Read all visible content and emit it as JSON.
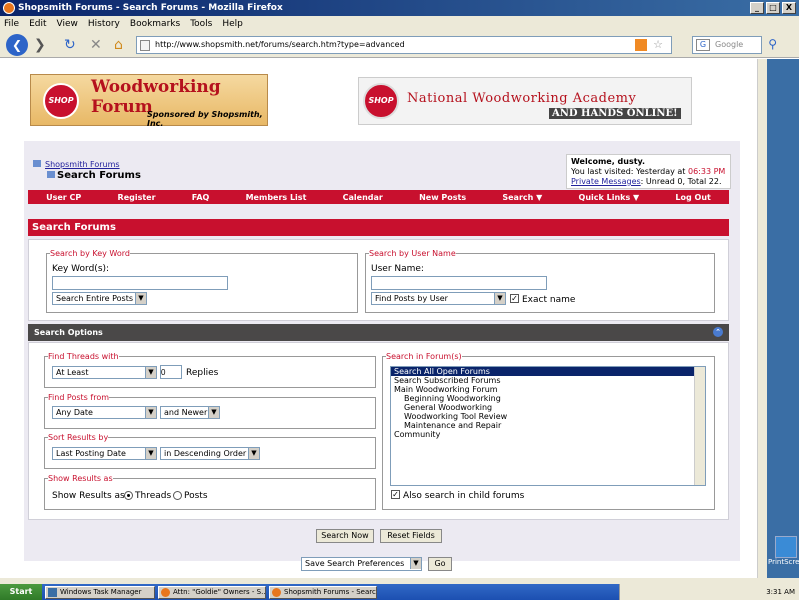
{
  "window": {
    "title": "Shopsmith Forums - Search Forums - Mozilla Firefox",
    "min": "_",
    "max": "□",
    "close": "X"
  },
  "menu": [
    "File",
    "Edit",
    "View",
    "History",
    "Bookmarks",
    "Tools",
    "Help"
  ],
  "browser": {
    "url": "http://www.shopsmith.net/forums/search.htm?type=advanced",
    "search_placeholder": "Google"
  },
  "logo1": {
    "brand": "SHOP SMITH",
    "line1": "Woodworking",
    "line2": "Forum",
    "sponsor": "Sponsored by Shopsmith, Inc."
  },
  "logo2": {
    "brand": "SHOP SMITH",
    "line1": "National Woodworking Academy",
    "line2": "AND HANDS ONLINE!"
  },
  "breadcrumb": {
    "parent": "Shopsmith Forums",
    "current": "Search Forums"
  },
  "welcome": {
    "greeting": "Welcome, dusty.",
    "visited_prefix": "You last visited: Yesterday at",
    "visited_time": "06:33 PM",
    "pm_link": "Private Messages",
    "pm_stats": ": Unread 0, Total 22."
  },
  "nav": [
    "User CP",
    "Register",
    "FAQ",
    "Members List",
    "Calendar",
    "New Posts",
    "Search ▼",
    "Quick Links ▼",
    "Log Out"
  ],
  "search_header": "Search Forums",
  "keyword": {
    "legend": "Search by Key Word",
    "label": "Key Word(s):",
    "value": "",
    "scope": "Search Entire Posts"
  },
  "username": {
    "legend": "Search by User Name",
    "label": "User Name:",
    "value": "",
    "mode": "Find Posts by User",
    "exact": "Exact name"
  },
  "options_header": "Search Options",
  "find_threads": {
    "legend": "Find Threads with",
    "mode": "At Least",
    "count": "0",
    "suffix": "Replies"
  },
  "find_posts": {
    "legend": "Find Posts from",
    "date": "Any Date",
    "dir": "and Newer"
  },
  "sort": {
    "legend": "Sort Results by",
    "field": "Last Posting Date",
    "order": "in Descending Order"
  },
  "show": {
    "legend": "Show Results as",
    "label": "Show Results as",
    "opt1": "Threads",
    "opt2": "Posts"
  },
  "forums": {
    "legend": "Search in Forum(s)",
    "items": [
      "Search All Open Forums",
      "Search Subscribed Forums",
      "Main Woodworking Forum",
      "Beginning Woodworking",
      "General Woodworking",
      "Woodworking Tool Review",
      "Maintenance and Repair",
      "Community"
    ],
    "child": "Also search in child forums"
  },
  "buttons": {
    "search": "Search Now",
    "reset": "Reset Fields",
    "prefs": "Save Search Preferences",
    "go": "Go"
  },
  "taskbar": {
    "start": "Start",
    "t1": "Windows Task Manager",
    "t2": "Attn: \"Goldie\" Owners - S...",
    "t3": "Shopsmith Forums - Searc...",
    "clock": "3:31 AM"
  },
  "desktop": {
    "icon": "PrintScre"
  }
}
